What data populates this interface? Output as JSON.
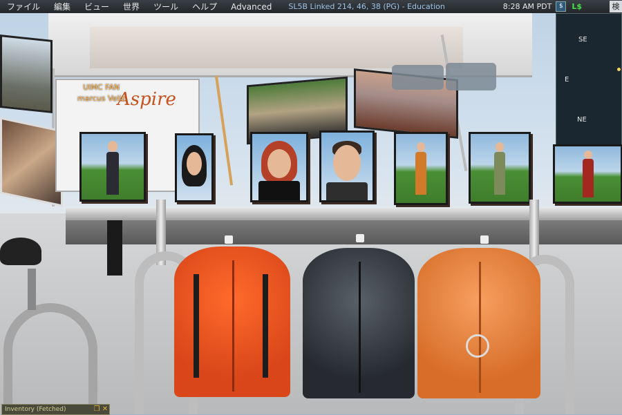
{
  "menu": {
    "items": [
      "ファイル",
      "編集",
      "ビュー",
      "世界",
      "ツール",
      "ヘルプ",
      "Advanced"
    ],
    "location": "SL5B Linked 214, 46, 38 (PG) - Education"
  },
  "status": {
    "time": "8:28 AM PDT",
    "currency": "L$",
    "search_stub": "検"
  },
  "minimap": {
    "directions": [
      "SE",
      "E",
      "NE"
    ]
  },
  "scene": {
    "hover_group": "UIMC FAN",
    "hover_name": "marcus Veliz",
    "sign_text": "Aspire"
  },
  "inventory": {
    "title": "Inventory (Fetched)",
    "minimize_icon": "minimize-icon",
    "close_icon": "close-icon"
  },
  "colors": {
    "menubar": "#2a2f35",
    "location_text": "#9cc4e8",
    "currency": "#47e04b",
    "hover_text": "#ffb247"
  }
}
